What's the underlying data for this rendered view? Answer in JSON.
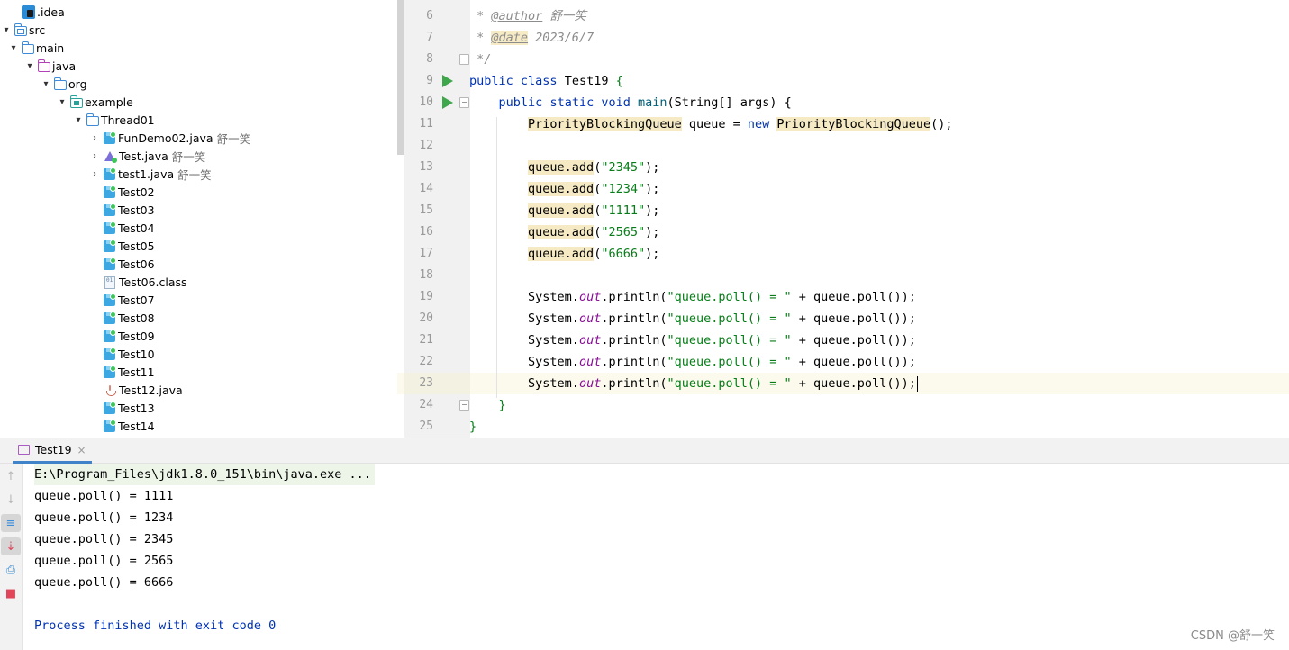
{
  "project_tree": {
    "items": [
      {
        "label": ".idea",
        "author": "",
        "icon": "idea-folder-icon",
        "arrow": ""
      },
      {
        "label": "src",
        "author": "",
        "icon": "source-folder-icon",
        "arrow": "▾"
      },
      {
        "label": "main",
        "author": "",
        "icon": "folder-icon",
        "arrow": "▾"
      },
      {
        "label": "java",
        "author": "",
        "icon": "source-root-icon",
        "arrow": "▾"
      },
      {
        "label": "org",
        "author": "",
        "icon": "folder-icon",
        "arrow": "▾"
      },
      {
        "label": "example",
        "author": "",
        "icon": "package-icon",
        "arrow": "▾"
      },
      {
        "label": "Thread01",
        "author": "",
        "icon": "folder-icon",
        "arrow": "▾"
      },
      {
        "label": "FunDemo02.java",
        "author": "舒一笑",
        "icon": "class-icon",
        "arrow": "›"
      },
      {
        "label": "Test.java",
        "author": "舒一笑",
        "icon": "test-class-icon",
        "arrow": "›"
      },
      {
        "label": "test1.java",
        "author": "舒一笑",
        "icon": "class-icon",
        "arrow": "›"
      },
      {
        "label": "Test02",
        "author": "",
        "icon": "class-icon",
        "arrow": ""
      },
      {
        "label": "Test03",
        "author": "",
        "icon": "class-icon",
        "arrow": ""
      },
      {
        "label": "Test04",
        "author": "",
        "icon": "class-icon",
        "arrow": ""
      },
      {
        "label": "Test05",
        "author": "",
        "icon": "class-icon",
        "arrow": ""
      },
      {
        "label": "Test06",
        "author": "",
        "icon": "class-icon",
        "arrow": ""
      },
      {
        "label": "Test06.class",
        "author": "",
        "icon": "class-file-icon",
        "arrow": ""
      },
      {
        "label": "Test07",
        "author": "",
        "icon": "class-icon",
        "arrow": ""
      },
      {
        "label": "Test08",
        "author": "",
        "icon": "class-icon",
        "arrow": ""
      },
      {
        "label": "Test09",
        "author": "",
        "icon": "class-icon",
        "arrow": ""
      },
      {
        "label": "Test10",
        "author": "",
        "icon": "class-icon",
        "arrow": ""
      },
      {
        "label": "Test11",
        "author": "",
        "icon": "class-icon",
        "arrow": ""
      },
      {
        "label": "Test12.java",
        "author": "",
        "icon": "java-file-icon",
        "arrow": ""
      },
      {
        "label": "Test13",
        "author": "",
        "icon": "class-icon",
        "arrow": ""
      },
      {
        "label": "Test14",
        "author": "",
        "icon": "class-icon",
        "arrow": ""
      }
    ]
  },
  "editor": {
    "lines": [
      {
        "n": "6",
        "kind": "author",
        "prefix": " * ",
        "tag": "@author",
        "text": " 舒一笑"
      },
      {
        "n": "7",
        "kind": "date",
        "prefix": " * ",
        "tag": "@date",
        "text": " 2023/6/7"
      },
      {
        "n": "8",
        "kind": "comment-end",
        "text": " */"
      },
      {
        "n": "9",
        "kind": "class",
        "kw1": "public",
        "kw2": "class",
        "name": "Test19",
        "rest": " {"
      },
      {
        "n": "10",
        "kind": "main",
        "kw1": "public",
        "kw2": "static",
        "kw3": "void",
        "name": "main",
        "rest": "(String[] args) {"
      },
      {
        "n": "11",
        "kind": "decl",
        "type": "PriorityBlockingQueue",
        "mid": " queue = ",
        "kw": "new",
        "ctor": "PriorityBlockingQueue",
        "rest": "();"
      },
      {
        "n": "12",
        "kind": "blank"
      },
      {
        "n": "13",
        "kind": "add",
        "call": "queue.add",
        "arg": "\"2345\""
      },
      {
        "n": "14",
        "kind": "add",
        "call": "queue.add",
        "arg": "\"1234\""
      },
      {
        "n": "15",
        "kind": "add",
        "call": "queue.add",
        "arg": "\"1111\""
      },
      {
        "n": "16",
        "kind": "add",
        "call": "queue.add",
        "arg": "\"2565\""
      },
      {
        "n": "17",
        "kind": "add",
        "call": "queue.add",
        "arg": "\"6666\""
      },
      {
        "n": "18",
        "kind": "blank"
      },
      {
        "n": "19",
        "kind": "print",
        "obj": "System.",
        "field": "out",
        "call": ".println(",
        "arg": "\"queue.poll() = \"",
        "rest": " + queue.poll());"
      },
      {
        "n": "20",
        "kind": "print",
        "obj": "System.",
        "field": "out",
        "call": ".println(",
        "arg": "\"queue.poll() = \"",
        "rest": " + queue.poll());"
      },
      {
        "n": "21",
        "kind": "print",
        "obj": "System.",
        "field": "out",
        "call": ".println(",
        "arg": "\"queue.poll() = \"",
        "rest": " + queue.poll());"
      },
      {
        "n": "22",
        "kind": "print",
        "obj": "System.",
        "field": "out",
        "call": ".println(",
        "arg": "\"queue.poll() = \"",
        "rest": " + queue.poll());"
      },
      {
        "n": "23",
        "kind": "print",
        "obj": "System.",
        "field": "out",
        "call": ".println(",
        "arg": "\"queue.poll() = \"",
        "rest": " + queue.poll());",
        "current": true
      },
      {
        "n": "24",
        "kind": "close",
        "text": "    }"
      },
      {
        "n": "25",
        "kind": "close",
        "text": "}"
      }
    ]
  },
  "run_panel": {
    "tab_label": "Test19",
    "console_lines": [
      {
        "text": "E:\\Program_Files\\jdk1.8.0_151\\bin\\java.exe ...",
        "kind": "cmd"
      },
      {
        "text": "queue.poll() = 1111",
        "kind": "out"
      },
      {
        "text": "queue.poll() = 1234",
        "kind": "out"
      },
      {
        "text": "queue.poll() = 2345",
        "kind": "out"
      },
      {
        "text": "queue.poll() = 2565",
        "kind": "out"
      },
      {
        "text": "queue.poll() = 6666",
        "kind": "out"
      },
      {
        "text": "",
        "kind": "out"
      },
      {
        "text": "Process finished with exit code 0",
        "kind": "exit"
      }
    ]
  },
  "watermark": "CSDN @舒一笑",
  "colors": {
    "keyword": "#0033b3",
    "string": "#067d17",
    "comment": "#8c8c8c",
    "field": "#871094",
    "run_green": "#3ea64b",
    "current_line": "#fcfaed",
    "highlight": "#f6eac5"
  }
}
